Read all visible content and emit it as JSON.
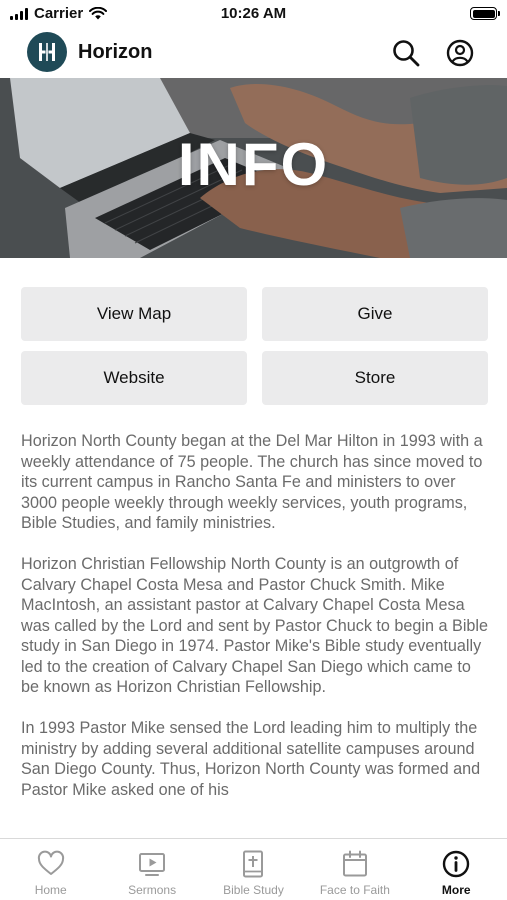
{
  "status_bar": {
    "carrier": "Carrier",
    "time": "10:26 AM"
  },
  "header": {
    "app_name": "Horizon",
    "logo_color": "#1f4a57"
  },
  "hero": {
    "title": "INFO"
  },
  "actions": [
    {
      "label": "View Map"
    },
    {
      "label": "Give"
    },
    {
      "label": "Website"
    },
    {
      "label": "Store"
    }
  ],
  "content": {
    "paragraphs": [
      "Horizon North County began at the Del Mar Hilton in 1993 with a weekly attendance of 75 people. The church has since moved to its current campus in Rancho Santa Fe and ministers to over 3000 people weekly through weekly services, youth programs, Bible Studies, and family ministries.",
      "Horizon Christian Fellowship North County is an outgrowth of Calvary Chapel Costa Mesa and Pastor Chuck Smith. Mike MacIntosh, an assistant pastor at Calvary Chapel Costa Mesa was called by the Lord and sent by Pastor Chuck to begin a Bible study in San Diego in 1974. Pastor Mike's Bible study eventually led to the creation of Calvary Chapel San Diego which came to be known as Horizon Christian Fellowship.",
      "In 1993 Pastor Mike sensed the Lord leading him to multiply the ministry by adding several additional satellite campuses around San Diego County. Thus, Horizon North County was formed and Pastor Mike asked one of his"
    ]
  },
  "tabs": [
    {
      "label": "Home",
      "icon": "heart-icon",
      "active": false
    },
    {
      "label": "Sermons",
      "icon": "video-icon",
      "active": false
    },
    {
      "label": "Bible Study",
      "icon": "bible-icon",
      "active": false
    },
    {
      "label": "Face to Faith",
      "icon": "calendar-icon",
      "active": false
    },
    {
      "label": "More",
      "icon": "info-icon",
      "active": true
    }
  ]
}
